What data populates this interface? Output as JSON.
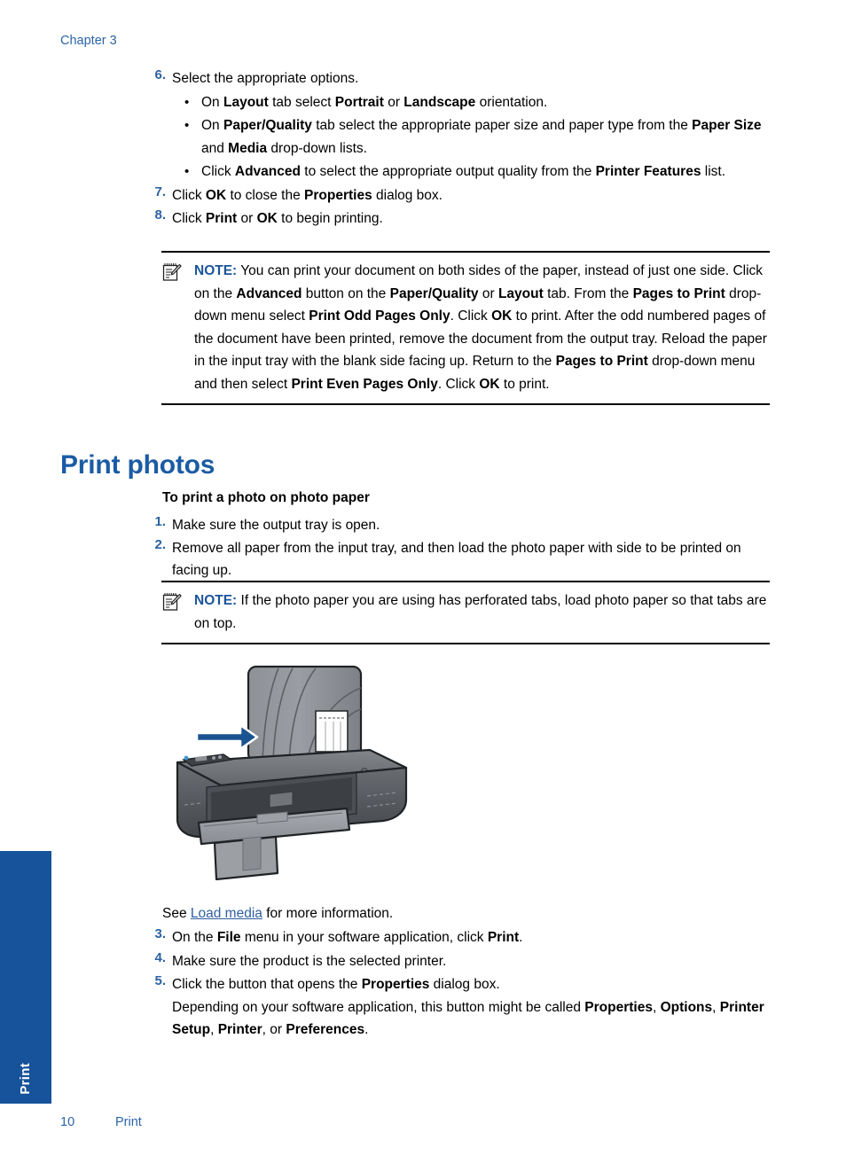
{
  "chapter": {
    "label": "Chapter 3"
  },
  "steps_top": [
    {
      "num": "6.",
      "text_html": "Select the appropriate options.",
      "bullets": [
        {
          "marker": "•",
          "text_html": "On <b>Layout</b> tab select <b>Portrait</b> or <b>Landscape</b> orientation."
        },
        {
          "marker": "•",
          "text_html": "On <b>Paper/Quality</b> tab select the appropriate paper size and paper type from the <b>Paper Size</b> and <b>Media</b> drop-down lists."
        },
        {
          "marker": "•",
          "text_html": "Click <b>Advanced</b> to select the appropriate output quality from the <b>Printer Features</b> list."
        }
      ]
    },
    {
      "num": "7.",
      "text_html": "Click <b>OK</b> to close the <b>Properties</b> dialog box.",
      "bullets": []
    },
    {
      "num": "8.",
      "text_html": "Click <b>Print</b> or <b>OK</b> to begin printing.",
      "bullets": []
    }
  ],
  "note_1": {
    "icon": "note-pencil-icon",
    "label": "NOTE:",
    "text_html": "You can print your document on both sides of the paper, instead of just one side. Click on the <b>Advanced</b> button on the <b>Paper/Quality</b> or <b>Layout</b> tab. From the <b>Pages to Print</b> drop-down menu select <b>Print Odd Pages Only</b>. Click <b>OK</b> to print. After the odd numbered pages of the document have been printed, remove the document from the output tray. Reload the paper in the input tray with the blank side facing up. Return to the <b>Pages to Print</b> drop-down menu and then select <b>Print Even Pages Only</b>. Click <b>OK</b> to print."
  },
  "section": {
    "title": "Print photos",
    "subtitle": "To print a photo on photo paper"
  },
  "steps_photo_a": [
    {
      "num": "1.",
      "text_html": "Make sure the output tray is open.",
      "bullets": []
    },
    {
      "num": "2.",
      "text_html": "Remove all paper from the input tray, and then load the photo paper with side to be printed on facing up.",
      "bullets": []
    }
  ],
  "note_2": {
    "icon": "note-pencil-icon",
    "label": "NOTE:",
    "text_html": "If the photo paper you are using has perforated tabs, load photo paper so that tabs are on top."
  },
  "figure": {
    "name": "printer-load-photo-paper-illustration",
    "arrow_color": "#1a5490",
    "body_color": "#6e7277",
    "tray_color": "#8d9196",
    "paper_color": "#fdfdfd"
  },
  "see_load": {
    "prefix": "See ",
    "link": "Load media",
    "suffix": " for more information."
  },
  "steps_photo_b": [
    {
      "num": "3.",
      "text_html": "On the <b>File</b> menu in your software application, click <b>Print</b>.",
      "bullets": []
    },
    {
      "num": "4.",
      "text_html": "Make sure the product is the selected printer.",
      "bullets": []
    },
    {
      "num": "5.",
      "text_html": "Click the button that opens the <b>Properties</b> dialog box.<br>Depending on your software application, this button might be called <b>Properties</b>, <b>Options</b>, <b>Printer Setup</b>, <b>Printer</b>, or <b>Preferences</b>.",
      "bullets": []
    }
  ],
  "side_tab": {
    "label": "Print",
    "color": "#16539a"
  },
  "footer": {
    "page": "10",
    "section": "Print"
  }
}
